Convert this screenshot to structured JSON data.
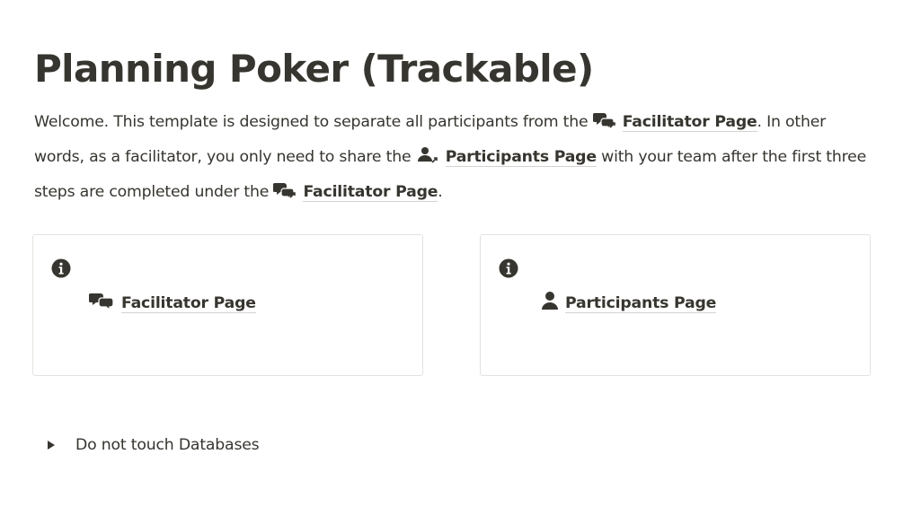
{
  "page": {
    "title": "Planning Poker (Trackable)",
    "intro": {
      "p1": "Welcome. This template is designed to separate all participants from the ",
      "m1": "Facilitator Page",
      "p2": ". In other words, as a facilitator, you only need to share the ",
      "m2": "Participants Page",
      "p3": " with your team after the first three steps are completed under the ",
      "m3": "Facilitator Page",
      "p4": "."
    }
  },
  "callouts": [
    {
      "icon": "info-icon",
      "link_icon": "comments-icon",
      "link_label": "Facilitator Page"
    },
    {
      "icon": "info-icon",
      "link_icon": "user-icon",
      "link_label": "Participants Page"
    }
  ],
  "toggle": {
    "icon": "triangle-right-icon",
    "label": "Do not touch Databases"
  },
  "colors": {
    "text": "#37352f",
    "border": "#e3e2df",
    "background": "#ffffff"
  }
}
